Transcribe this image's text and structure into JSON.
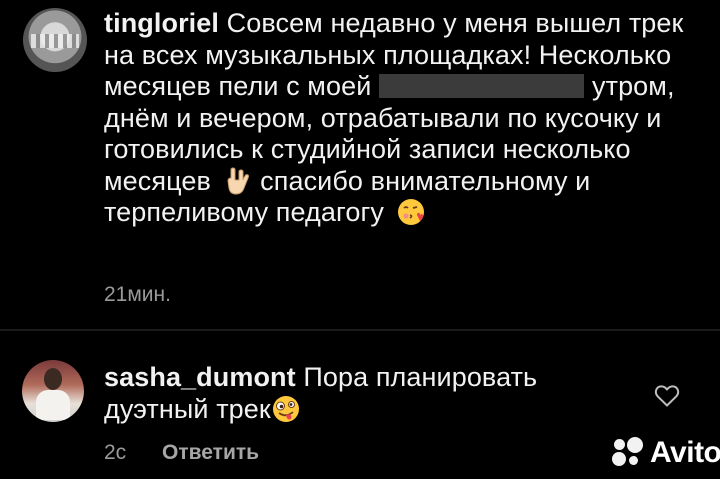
{
  "comments": [
    {
      "username": "tingloriel",
      "text_part1": "Совсем недавно у меня вышел трек на всех музыкальных площадках! Несколько месяцев пели с моей",
      "text_part2": "утром, днём и вечером, отрабатывали по кусочку и готовились к студийной записи несколько месяцев",
      "text_part3": "спасибо внимательному и терпеливому педагогу",
      "emoji_1": "rock-on-hand",
      "emoji_2": "face-blowing-kiss",
      "time": "21мин."
    },
    {
      "username": "sasha_dumont",
      "text": "Пора планировать дуэтный трек",
      "emoji": "zany-face",
      "time": "2с",
      "reply_label": "Ответить",
      "like_icon": "heart-outline-icon"
    }
  ],
  "watermark": {
    "text": "Avito"
  },
  "colors": {
    "background": "#000000",
    "text": "#f2f2f2",
    "meta": "#9a9a9a",
    "redaction": "#3b3b3b"
  }
}
